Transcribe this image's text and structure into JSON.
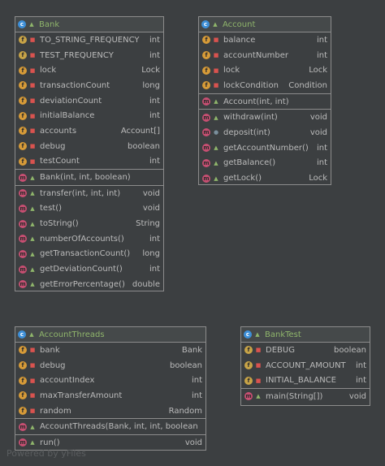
{
  "classes": {
    "bank": {
      "name": "Bank",
      "fields": [
        {
          "name": "TO_STRING_FREQUENCY",
          "type": "int",
          "icon": "static-field-icon",
          "vis": "private"
        },
        {
          "name": "TEST_FREQUENCY",
          "type": "int",
          "icon": "static-field-icon",
          "vis": "private"
        },
        {
          "name": "lock",
          "type": "Lock",
          "icon": "field-icon",
          "vis": "private"
        },
        {
          "name": "transactionCount",
          "type": "long",
          "icon": "field-icon",
          "vis": "private"
        },
        {
          "name": "deviationCount",
          "type": "int",
          "icon": "field-icon",
          "vis": "private"
        },
        {
          "name": "initialBalance",
          "type": "int",
          "icon": "field-icon",
          "vis": "private"
        },
        {
          "name": "accounts",
          "type": "Account[]",
          "icon": "field-icon",
          "vis": "private"
        },
        {
          "name": "debug",
          "type": "boolean",
          "icon": "field-icon",
          "vis": "private"
        },
        {
          "name": "testCount",
          "type": "int",
          "icon": "field-icon",
          "vis": "private"
        }
      ],
      "constructors": [
        {
          "name": "Bank(int, int, boolean)",
          "type": "",
          "vis": "public"
        }
      ],
      "methods": [
        {
          "name": "transfer(int, int, int)",
          "type": "void",
          "vis": "public"
        },
        {
          "name": "test()",
          "type": "void",
          "vis": "public"
        },
        {
          "name": "toString()",
          "type": "String",
          "vis": "public"
        },
        {
          "name": "numberOfAccounts()",
          "type": "int",
          "vis": "public"
        },
        {
          "name": "getTransactionCount()",
          "type": "long",
          "vis": "public"
        },
        {
          "name": "getDeviationCount()",
          "type": "int",
          "vis": "public"
        },
        {
          "name": "getErrorPercentage()",
          "type": "double",
          "vis": "public"
        }
      ]
    },
    "account": {
      "name": "Account",
      "fields": [
        {
          "name": "balance",
          "type": "int",
          "icon": "field-icon",
          "vis": "private"
        },
        {
          "name": "accountNumber",
          "type": "int",
          "icon": "field-icon",
          "vis": "private"
        },
        {
          "name": "lock",
          "type": "Lock",
          "icon": "field-icon",
          "vis": "private"
        },
        {
          "name": "lockCondition",
          "type": "Condition",
          "icon": "field-icon",
          "vis": "private"
        }
      ],
      "constructors": [
        {
          "name": "Account(int, int)",
          "type": "",
          "vis": "public"
        }
      ],
      "methods": [
        {
          "name": "withdraw(int)",
          "type": "void",
          "vis": "public"
        },
        {
          "name": "deposit(int)",
          "type": "void",
          "vis": "package"
        },
        {
          "name": "getAccountNumber()",
          "type": "int",
          "vis": "public"
        },
        {
          "name": "getBalance()",
          "type": "int",
          "vis": "public"
        },
        {
          "name": "getLock()",
          "type": "Lock",
          "vis": "public"
        }
      ]
    },
    "accountThreads": {
      "name": "AccountThreads",
      "fields": [
        {
          "name": "bank",
          "type": "Bank",
          "icon": "field-icon",
          "vis": "private"
        },
        {
          "name": "debug",
          "type": "boolean",
          "icon": "field-icon",
          "vis": "private"
        },
        {
          "name": "accountIndex",
          "type": "int",
          "icon": "field-icon",
          "vis": "private"
        },
        {
          "name": "maxTransferAmount",
          "type": "int",
          "icon": "field-icon",
          "vis": "private"
        },
        {
          "name": "random",
          "type": "Random",
          "icon": "field-icon",
          "vis": "private"
        }
      ],
      "constructors": [
        {
          "name": "AccountThreads(Bank, int, int, boolean)",
          "type": "",
          "vis": "public"
        }
      ],
      "methods": [
        {
          "name": "run()",
          "type": "void",
          "vis": "public"
        }
      ]
    },
    "bankTest": {
      "name": "BankTest",
      "fields": [
        {
          "name": "DEBUG",
          "type": "boolean",
          "icon": "static-field-icon",
          "vis": "private"
        },
        {
          "name": "ACCOUNT_AMOUNT",
          "type": "int",
          "icon": "static-field-icon",
          "vis": "private"
        },
        {
          "name": "INITIAL_BALANCE",
          "type": "int",
          "icon": "static-field-icon",
          "vis": "private"
        }
      ],
      "constructors": [],
      "methods": [
        {
          "name": "main(String[])",
          "type": "void",
          "vis": "public",
          "static": true
        }
      ]
    }
  },
  "watermark": "Powered by yFiles",
  "colors": {
    "background": "#3c3f41",
    "border": "#8c8c8c",
    "class_name": "#8fb56b",
    "class_icon": "#3d8fd8",
    "field_icon": "#d79b38",
    "method_icon": "#c74f72"
  }
}
